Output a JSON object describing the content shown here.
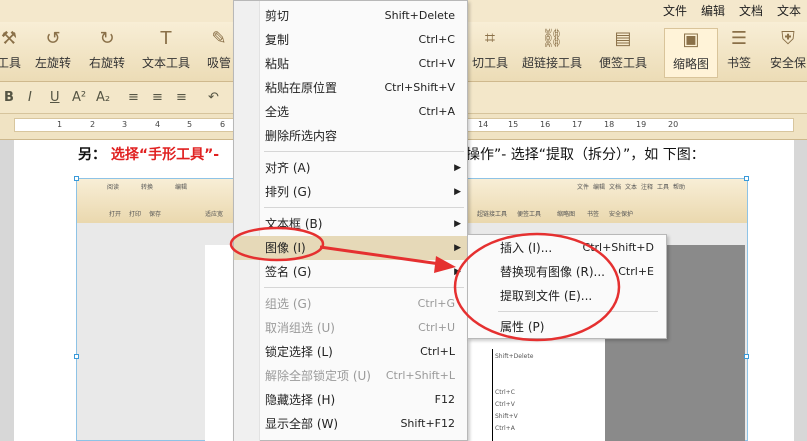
{
  "menubar": {
    "items": [
      "文件",
      "编辑",
      "文档",
      "文本"
    ]
  },
  "toolbar": {
    "items": [
      {
        "label": "工具",
        "icon": "tool-icon"
      },
      {
        "label": "左旋转",
        "icon": "rotate-left-icon"
      },
      {
        "label": "右旋转",
        "icon": "rotate-right-icon"
      },
      {
        "label": "文本工具",
        "icon": "text-tool-icon"
      },
      {
        "label": "吸管",
        "icon": "eyedropper-icon"
      },
      {
        "label": "切工具",
        "icon": "crop-icon"
      },
      {
        "label": "超链接工具",
        "icon": "link-icon"
      },
      {
        "label": "便签工具",
        "icon": "note-icon"
      },
      {
        "label": "缩略图",
        "icon": "thumbnail-icon"
      },
      {
        "label": "书签",
        "icon": "bookmark-icon"
      },
      {
        "label": "安全保",
        "icon": "security-icon"
      }
    ]
  },
  "format": {
    "items": [
      "B",
      "I",
      "U",
      "A²",
      "A₂",
      "≡",
      "≡",
      "≡",
      "↶"
    ]
  },
  "ruler": {
    "numbers": [
      "1",
      "2",
      "3",
      "4",
      "5",
      "6",
      "7",
      "8",
      "9",
      "10",
      "11",
      "12",
      "13",
      "14",
      "15",
      "16",
      "17",
      "18",
      "19",
      "20"
    ]
  },
  "doc": {
    "prefix": "另：",
    "red_text": "选择“手形工具”-",
    "rest": "操作”- 选择“提取（拆分）”，如 下图："
  },
  "context_menu": {
    "items": [
      {
        "label": "剪切",
        "shortcut": "Shift+Delete"
      },
      {
        "label": "复制",
        "shortcut": "Ctrl+C"
      },
      {
        "label": "粘贴",
        "shortcut": "Ctrl+V"
      },
      {
        "label": "粘贴在原位置",
        "shortcut": "Ctrl+Shift+V"
      },
      {
        "label": "全选",
        "shortcut": "Ctrl+A"
      },
      {
        "label": "删除所选内容",
        "shortcut": ""
      },
      {
        "label": "对齐 (A)",
        "shortcut": ""
      },
      {
        "label": "排列 (G)",
        "shortcut": ""
      },
      {
        "label": "文本框 (B)",
        "shortcut": ""
      },
      {
        "label": "图像 (I)",
        "shortcut": ""
      },
      {
        "label": "签名 (G)",
        "shortcut": ""
      },
      {
        "label": "组选 (G)",
        "shortcut": "Ctrl+G"
      },
      {
        "label": "取消组选 (U)",
        "shortcut": "Ctrl+U"
      },
      {
        "label": "锁定选择 (L)",
        "shortcut": "Ctrl+L"
      },
      {
        "label": "解除全部锁定项 (U)",
        "shortcut": "Ctrl+Shift+L"
      },
      {
        "label": "隐藏选择 (H)",
        "shortcut": "F12"
      },
      {
        "label": "显示全部 (W)",
        "shortcut": "Shift+F12"
      }
    ]
  },
  "sub_menu": {
    "items": [
      {
        "label": "插入 (I)...",
        "shortcut": "Ctrl+Shift+D"
      },
      {
        "label": "替换现有图像 (R)...",
        "shortcut": "Ctrl+E"
      },
      {
        "label": "提取到文件 (E)...",
        "shortcut": ""
      },
      {
        "label": "属性 (P)",
        "shortcut": ""
      }
    ]
  },
  "embedded": {
    "tabs": [
      "阅读",
      "转换",
      "编辑"
    ],
    "menu": [
      "文件",
      "编辑",
      "文档",
      "文本",
      "注释",
      "工具",
      "帮助"
    ],
    "tools": [
      "打开",
      "打印",
      "保存",
      "适应宽",
      "超链接工具",
      "便签工具",
      "缩略图",
      "书签",
      "安全保护",
      "总体工具"
    ],
    "shortcuts": [
      "Shift+Delete",
      "Ctrl+C",
      "Ctrl+V",
      "Shift+V",
      "Ctrl+A"
    ]
  },
  "colors": {
    "accent_red": "#e02020",
    "menu_highlight": "#e6d9b8",
    "toolbar_bg": "#f3e7c9"
  }
}
